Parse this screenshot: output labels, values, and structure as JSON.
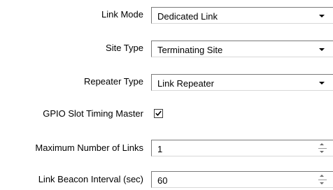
{
  "fields": {
    "link_mode": {
      "label": "Link Mode",
      "value": "Dedicated Link"
    },
    "site_type": {
      "label": "Site Type",
      "value": "Terminating Site"
    },
    "repeater_type": {
      "label": "Repeater Type",
      "value": "Link Repeater"
    },
    "gpio_slot_timing_master": {
      "label": "GPIO Slot Timing Master",
      "checked": true
    },
    "max_links": {
      "label": "Maximum Number of Links",
      "value": "1"
    },
    "link_beacon_interval": {
      "label": "Link Beacon Interval (sec)",
      "value": "60"
    }
  },
  "icons": {
    "dropdown": "chevron-down-icon",
    "spin_up": "spin-up-icon",
    "spin_down": "spin-down-icon",
    "check": "checkmark-icon"
  }
}
